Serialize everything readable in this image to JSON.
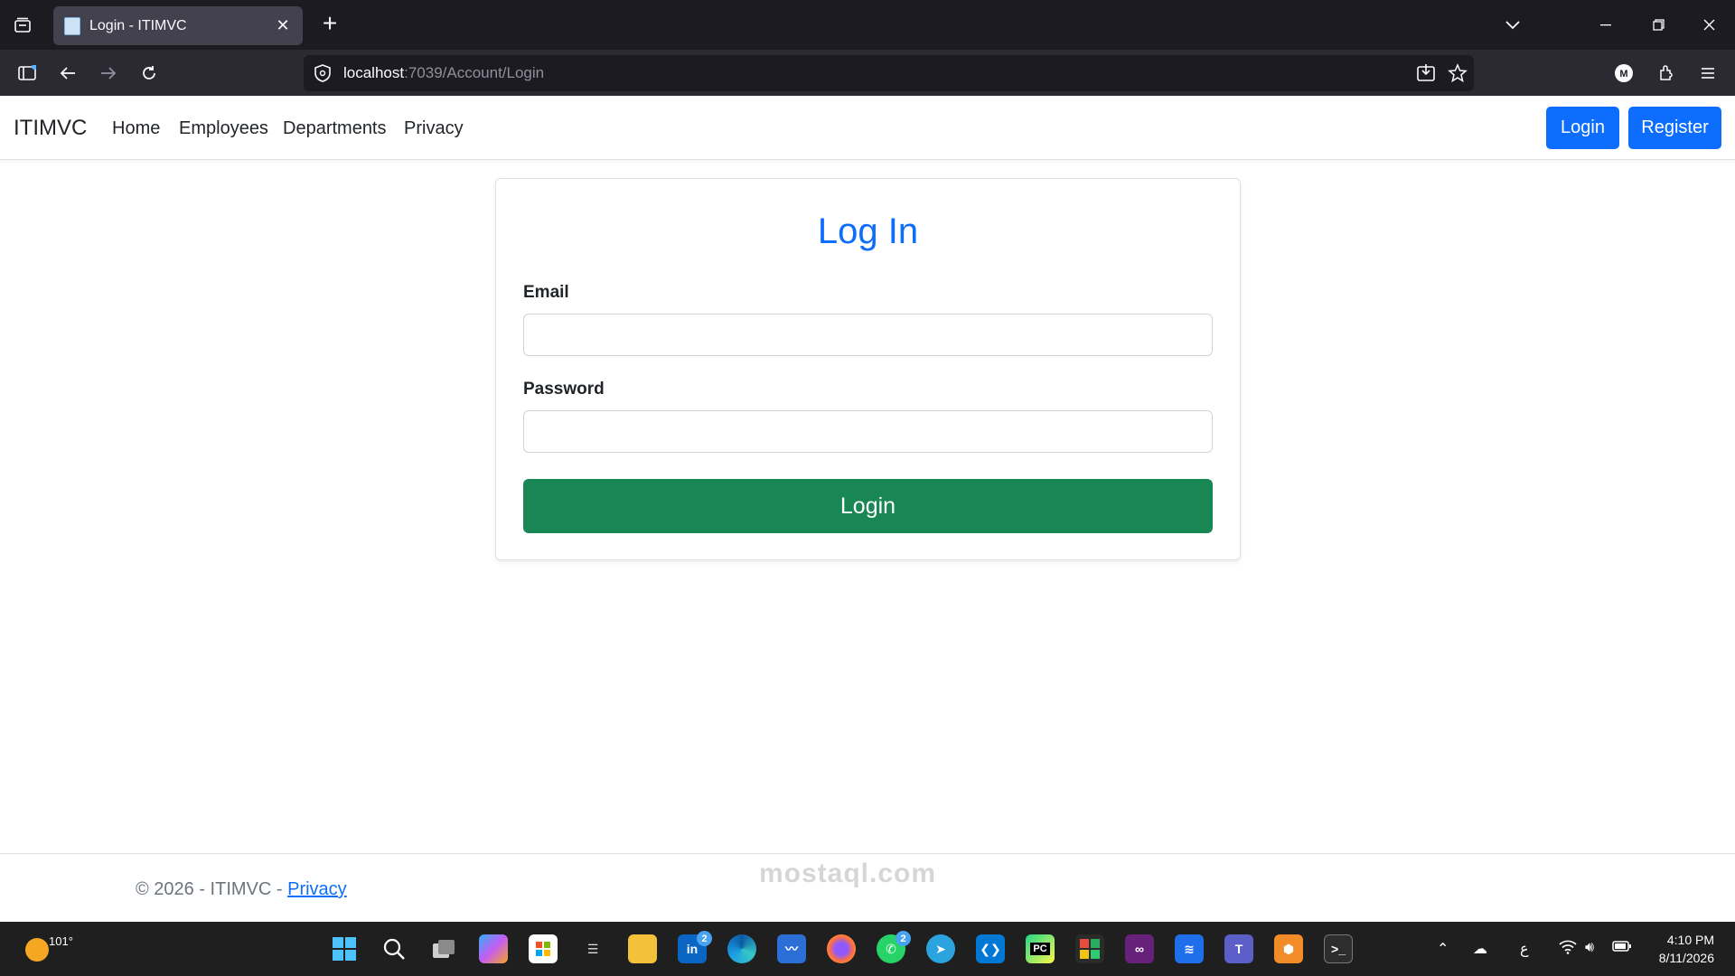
{
  "browser": {
    "tab_title": "Login - ITIMVC",
    "url_host": "localhost",
    "url_path": ":7039/Account/Login"
  },
  "site_nav": {
    "brand": "ITIMVC",
    "links": [
      "Home",
      "Employees",
      "Departments",
      "Privacy"
    ],
    "login_label": "Login",
    "register_label": "Register"
  },
  "form": {
    "heading": "Log In",
    "email_label": "Email",
    "email_value": "",
    "password_label": "Password",
    "password_value": "",
    "submit_label": "Login"
  },
  "footer": {
    "copyright": "© 2026 - ITIMVC - ",
    "privacy_link": "Privacy"
  },
  "watermark": "mostaql.com",
  "taskbar": {
    "weather_temp": "101°",
    "badges": [
      "2",
      "2"
    ],
    "clock_time": "4:10 PM",
    "clock_date": "8/11/2026",
    "input_indicator": "ع"
  },
  "colors": {
    "primary": "#0d6efd",
    "success": "#198754",
    "browser_dark": "#1c1b22",
    "taskbar": "#1f1f1f"
  }
}
